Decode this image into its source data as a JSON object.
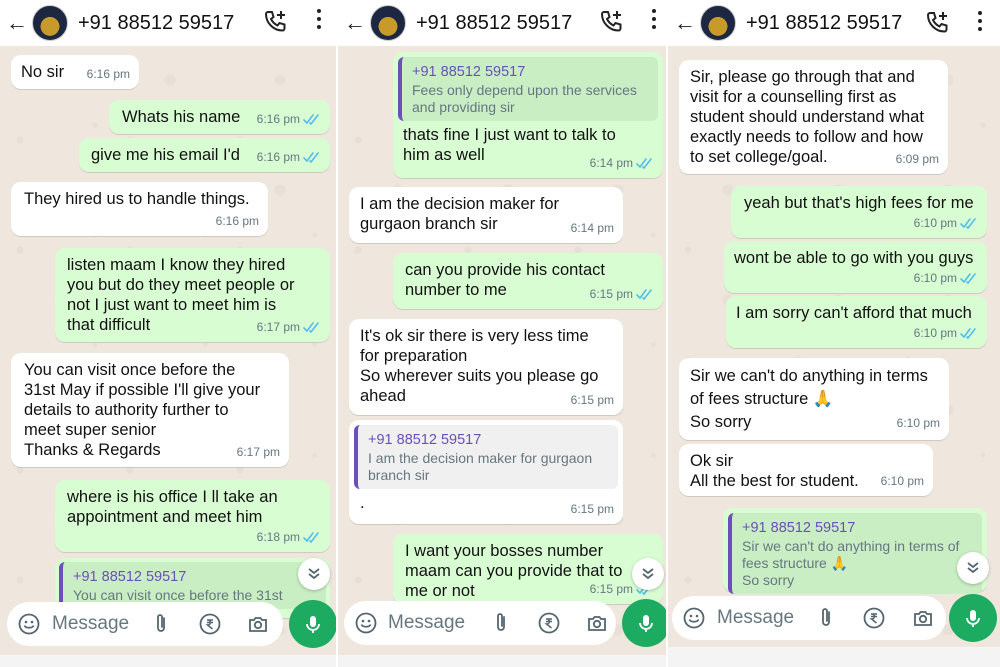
{
  "contact": "+91 88512 59517",
  "input_placeholder": "Message",
  "panel1": {
    "messages": [
      {
        "dir": "in",
        "text": "No sir",
        "time": "6:16 pm"
      },
      {
        "dir": "out",
        "text": "Whats his name",
        "time": "6:16 pm"
      },
      {
        "dir": "out",
        "text": "give me his email I'd",
        "time": "6:16 pm"
      },
      {
        "dir": "in",
        "text": "They hired us to handle things.",
        "time": "6:16 pm"
      },
      {
        "dir": "out",
        "text": "listen maam I know they hired\nyou but do they meet people or\nnot I just want to meet him is\nthat difficult",
        "time": "6:17 pm"
      },
      {
        "dir": "in",
        "text": "You can visit once before the\n31st May if possible I'll give your\ndetails to authority further to\nmeet super senior\nThanks & Regards",
        "time": "6:17 pm"
      },
      {
        "dir": "out",
        "text": "where is his office I ll take an\nappointment and meet him",
        "time": "6:18 pm"
      },
      {
        "dir": "out",
        "quote_name": "+91 88512 59517",
        "quote_text": "You can visit once before the 31st",
        "text": "",
        "time": ""
      }
    ]
  },
  "panel2": {
    "messages": [
      {
        "dir": "out",
        "quote_name": "+91 88512 59517",
        "quote_text": "Fees only depend upon the services\nand providing sir",
        "text": "thats fine I just want to talk to\nhim as well",
        "time": "6:14 pm"
      },
      {
        "dir": "in",
        "text": "I am the decision maker for\ngurgaon branch sir",
        "time": "6:14 pm"
      },
      {
        "dir": "out",
        "text": "can you provide his contact\nnumber to me",
        "time": "6:15 pm"
      },
      {
        "dir": "in",
        "text": "It's ok sir there is very less time\nfor preparation\nSo wherever suits you please go\nahead",
        "time": "6:15 pm"
      },
      {
        "dir": "in",
        "quote_name": "+91 88512 59517",
        "quote_text": "I am the decision maker for gurgaon\nbranch sir",
        "text": ".",
        "time": "6:15 pm"
      },
      {
        "dir": "out",
        "text": "I want your bosses number\nmaam can you provide that to\nme or not",
        "time": "6:15 pm"
      }
    ]
  },
  "panel3": {
    "messages": [
      {
        "dir": "in",
        "text": "Sir, please go through that and\nvisit for a counselling first as\nstudent should understand what\nexactly needs to follow and how\nto set college/goal.",
        "time": "6:09 pm"
      },
      {
        "dir": "out",
        "text": "yeah but that's high fees for me",
        "time": "6:10 pm"
      },
      {
        "dir": "out",
        "text": "wont be able to go with you guys",
        "time": "6:10 pm"
      },
      {
        "dir": "out",
        "text": "I am sorry can't afford that much",
        "time": "6:10 pm"
      },
      {
        "dir": "in",
        "text": "Sir we can't do anything in terms\nof fees structure 🙏\nSo sorry",
        "time": "6:10 pm"
      },
      {
        "dir": "in",
        "text": "Ok sir\nAll the best for student.",
        "time": "6:10 pm"
      },
      {
        "dir": "out",
        "quote_name": "+91 88512 59517",
        "quote_text": "Sir we can't do anything in terms of\nfees structure 🙏\nSo sorry",
        "text": "",
        "time": ""
      }
    ]
  },
  "colors": {
    "outgoing": "#d9fdd3",
    "incoming": "#ffffff",
    "accent": "#1daa61",
    "ticks": "#53bdeb",
    "quote_name": "#6b4fbb"
  },
  "icons": [
    "back-arrow-icon",
    "add-call-icon",
    "more-options-icon",
    "emoji-icon",
    "attach-icon",
    "payment-icon",
    "camera-icon",
    "mic-icon",
    "scroll-down-icon",
    "read-ticks-icon"
  ]
}
